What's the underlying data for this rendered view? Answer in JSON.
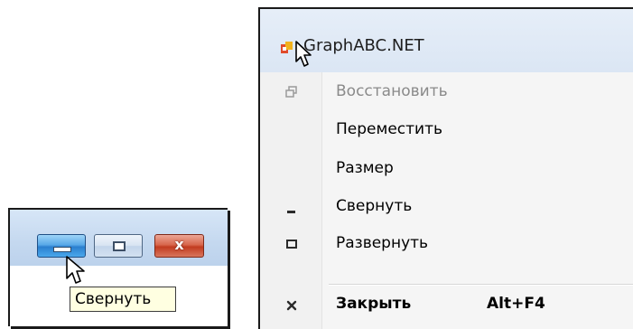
{
  "left_window": {
    "buttons": {
      "minimize_icon": "minimize-icon",
      "maximize_icon": "maximize-icon",
      "close_icon": "close-icon",
      "close_glyph": "x"
    },
    "tooltip": "Свернуть"
  },
  "system_menu": {
    "title": "GraphABC.NET",
    "app_icon": "graphabc-app-icon",
    "items": [
      {
        "label": "Восстановить",
        "icon": "restore-icon",
        "disabled": true
      },
      {
        "label": "Переместить",
        "icon": "",
        "disabled": false
      },
      {
        "label": "Размер",
        "icon": "",
        "disabled": false
      },
      {
        "label": "Свернуть",
        "icon": "minimize-icon",
        "disabled": false
      },
      {
        "label": "Развернуть",
        "icon": "maximize-icon",
        "disabled": false
      },
      {
        "label": "Закрыть",
        "icon": "close-icon",
        "shortcut": "Alt+F4",
        "bold": true
      }
    ]
  },
  "colors": {
    "tooltip_bg": "#ffffe1",
    "close_red": "#c23b1f",
    "minimize_blue": "#2a7fcf",
    "menu_bg": "#f5f5f5"
  }
}
